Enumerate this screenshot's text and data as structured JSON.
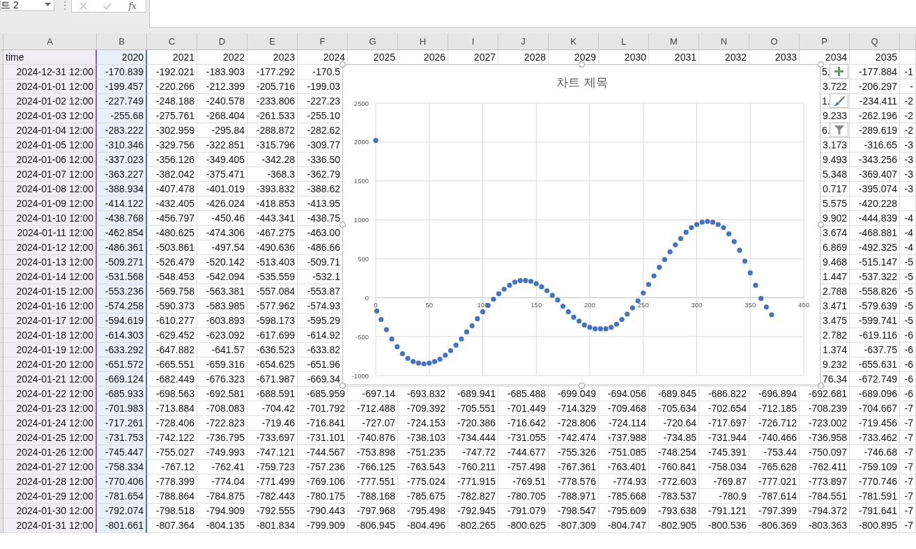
{
  "toolbar": {
    "name_box": "트 2",
    "function_button": "fx"
  },
  "sheet": {
    "columns": [
      {
        "letter": "A",
        "color": "#8064a2"
      },
      {
        "letter": "B",
        "color": "#4472c4"
      },
      {
        "letter": "C"
      },
      {
        "letter": "D"
      },
      {
        "letter": "E"
      },
      {
        "letter": "F"
      },
      {
        "letter": "G"
      },
      {
        "letter": "H"
      },
      {
        "letter": "I"
      },
      {
        "letter": "J"
      },
      {
        "letter": "K"
      },
      {
        "letter": "L"
      },
      {
        "letter": "M"
      },
      {
        "letter": "N"
      },
      {
        "letter": "O"
      },
      {
        "letter": "P"
      },
      {
        "letter": "Q"
      }
    ],
    "rows": [
      {
        "kind": "header",
        "cells": [
          "time",
          "2020",
          "2021",
          "2022",
          "2023",
          "2024",
          "2025",
          "2026",
          "2027",
          "2028",
          "2029",
          "2030",
          "2031",
          "2032",
          "2033",
          "2034",
          "2035",
          null
        ]
      },
      {
        "kind": "data",
        "cells": [
          "2024-12-31 12:00",
          "-170.839",
          "-192.021",
          "-183.903",
          "-177.292",
          "-170.5",
          null,
          null,
          null,
          null,
          null,
          null,
          null,
          null,
          null,
          "5.",
          "-177.884",
          "-1"
        ]
      },
      {
        "kind": "data",
        "cells": [
          "2024-01-01 12:00",
          "-199.457",
          "-220.266",
          "-212.399",
          "-205.716",
          "-199.03",
          null,
          null,
          null,
          null,
          null,
          null,
          null,
          null,
          null,
          "3.722",
          "-206.297",
          "-"
        ]
      },
      {
        "kind": "data",
        "cells": [
          "2024-01-02 12:00",
          "-227.749",
          "-248.188",
          "-240.578",
          "-233.806",
          "-227.23",
          null,
          null,
          null,
          null,
          null,
          null,
          null,
          null,
          null,
          "1.",
          "-234.411",
          "-2"
        ]
      },
      {
        "kind": "data",
        "cells": [
          "2024-01-03 12:00",
          "-255.68",
          "-275.761",
          "-268.404",
          "-261.533",
          "-255.10",
          null,
          null,
          null,
          null,
          null,
          null,
          null,
          null,
          null,
          "9.233",
          "-262.196",
          "-2"
        ]
      },
      {
        "kind": "data",
        "cells": [
          "2024-01-04 12:00",
          "-283.222",
          "-302.959",
          "-295.84",
          "-288.872",
          "-282.62",
          null,
          null,
          null,
          null,
          null,
          null,
          null,
          null,
          null,
          "6.",
          "-289.619",
          "-2"
        ]
      },
      {
        "kind": "data",
        "cells": [
          "2024-01-05 12:00",
          "-310.346",
          "-329.756",
          "-322.851",
          "-315.796",
          "-309.77",
          null,
          null,
          null,
          null,
          null,
          null,
          null,
          null,
          null,
          "3.173",
          "-316.65",
          "-3"
        ]
      },
      {
        "kind": "data",
        "cells": [
          "2024-01-06 12:00",
          "-337.023",
          "-356.126",
          "-349.405",
          "-342.28",
          "-336.50",
          null,
          null,
          null,
          null,
          null,
          null,
          null,
          null,
          null,
          "9.493",
          "-343.256",
          "-3"
        ]
      },
      {
        "kind": "data",
        "cells": [
          "2024-01-07 12:00",
          "-363.227",
          "-382.042",
          "-375.471",
          "-368.3",
          "-362.79",
          null,
          null,
          null,
          null,
          null,
          null,
          null,
          null,
          null,
          "5.348",
          "-369.407",
          "-3"
        ]
      },
      {
        "kind": "data",
        "cells": [
          "2024-01-08 12:00",
          "-388.934",
          "-407.478",
          "-401.019",
          "-393.832",
          "-388.62",
          null,
          null,
          null,
          null,
          null,
          null,
          null,
          null,
          null,
          "0.717",
          "-395.074",
          "-3"
        ]
      },
      {
        "kind": "data",
        "cells": [
          "2024-01-09 12:00",
          "-414.122",
          "-432.405",
          "-426.024",
          "-418.853",
          "-413.95",
          null,
          null,
          null,
          null,
          null,
          null,
          null,
          null,
          null,
          "5.575",
          "-420.228",
          null
        ]
      },
      {
        "kind": "data",
        "cells": [
          "2024-01-10 12:00",
          "-438.768",
          "-456.797",
          "-450.46",
          "-443.341",
          "-438.75",
          null,
          null,
          null,
          null,
          null,
          null,
          null,
          null,
          null,
          "9.902",
          "-444.839",
          "-4"
        ]
      },
      {
        "kind": "data",
        "cells": [
          "2024-01-11 12:00",
          "-462.854",
          "-480.625",
          "-474.306",
          "-467.275",
          "-463.00",
          null,
          null,
          null,
          null,
          null,
          null,
          null,
          null,
          null,
          "3.674",
          "-468.881",
          "-4"
        ]
      },
      {
        "kind": "data",
        "cells": [
          "2024-01-12 12:00",
          "-486.361",
          "-503.861",
          "-497.54",
          "-490.636",
          "-486.66",
          null,
          null,
          null,
          null,
          null,
          null,
          null,
          null,
          null,
          "6.869",
          "-492.325",
          "-4"
        ]
      },
      {
        "kind": "data",
        "cells": [
          "2024-01-13 12:00",
          "-509.271",
          "-526.479",
          "-520.142",
          "-513.403",
          "-509.71",
          null,
          null,
          null,
          null,
          null,
          null,
          null,
          null,
          null,
          "9.468",
          "-515.147",
          "-5"
        ]
      },
      {
        "kind": "data",
        "cells": [
          "2024-01-14 12:00",
          "-531.568",
          "-548.453",
          "-542.094",
          "-535.559",
          "-532.1",
          null,
          null,
          null,
          null,
          null,
          null,
          null,
          null,
          null,
          "1.447",
          "-537.322",
          "-5"
        ]
      },
      {
        "kind": "data",
        "cells": [
          "2024-01-15 12:00",
          "-553.236",
          "-569.758",
          "-563.381",
          "-557.084",
          "-553.87",
          null,
          null,
          null,
          null,
          null,
          null,
          null,
          null,
          null,
          "2.788",
          "-558.826",
          "-5"
        ]
      },
      {
        "kind": "data",
        "cells": [
          "2024-01-16 12:00",
          "-574.258",
          "-590.373",
          "-583.985",
          "-577.962",
          "-574.93",
          null,
          null,
          null,
          null,
          null,
          null,
          null,
          null,
          null,
          "3.471",
          "-579.639",
          "-5"
        ]
      },
      {
        "kind": "data",
        "cells": [
          "2024-01-17 12:00",
          "-594.619",
          "-610.277",
          "-603.893",
          "-598.173",
          "-595.29",
          null,
          null,
          null,
          null,
          null,
          null,
          null,
          null,
          null,
          "3.475",
          "-599.741",
          "-5"
        ]
      },
      {
        "kind": "data",
        "cells": [
          "2024-01-18 12:00",
          "-614.303",
          "-629.452",
          "-623.092",
          "-617.699",
          "-614.92",
          null,
          null,
          null,
          null,
          null,
          null,
          null,
          null,
          null,
          "2.782",
          "-619.116",
          "-6"
        ]
      },
      {
        "kind": "data",
        "cells": [
          "2024-01-19 12:00",
          "-633.292",
          "-647.882",
          "-641.57",
          "-636.523",
          "-633.82",
          null,
          null,
          null,
          null,
          null,
          null,
          null,
          null,
          null,
          "1.374",
          "-637.75",
          "-6"
        ]
      },
      {
        "kind": "data",
        "cells": [
          "2024-01-20 12:00",
          "-651.572",
          "-665.551",
          "-659.316",
          "-654.625",
          "-651.96",
          null,
          null,
          null,
          null,
          null,
          null,
          null,
          null,
          null,
          "9.232",
          "-655.631",
          "-6"
        ]
      },
      {
        "kind": "data",
        "cells": [
          "2024-01-21 12:00",
          "-669.124",
          "-682.449",
          "-676.323",
          "-671.987",
          "-669.34",
          null,
          null,
          null,
          null,
          null,
          null,
          null,
          null,
          null,
          "76.34",
          "-672.749",
          "-6"
        ]
      },
      {
        "kind": "data",
        "cells": [
          "2024-01-22 12:00",
          "-685.933",
          "-698.563",
          "-692.581",
          "-688.591",
          "-685.959",
          "-697.14",
          "-693.832",
          "-689.941",
          "-685.488",
          "-699.049",
          "-694.056",
          "-689.845",
          "-686.822",
          "-696.894",
          "-692.681",
          "-689.096",
          "-6"
        ]
      },
      {
        "kind": "data",
        "cells": [
          "2024-01-23 12:00",
          "-701.983",
          "-713.884",
          "-708.083",
          "-704.42",
          "-701.792",
          "-712.488",
          "-709.392",
          "-705.551",
          "-701.449",
          "-714.329",
          "-709.468",
          "-705.634",
          "-702.654",
          "-712.185",
          "-708.239",
          "-704.667",
          "-7"
        ]
      },
      {
        "kind": "data",
        "cells": [
          "2024-01-24 12:00",
          "-717.261",
          "-728.406",
          "-722.823",
          "-719.46",
          "-716.841",
          "-727.07",
          "-724.153",
          "-720.386",
          "-716.642",
          "-728.806",
          "-724.114",
          "-720.64",
          "-717.697",
          "-726.712",
          "-723.002",
          "-719.456",
          "-7"
        ]
      },
      {
        "kind": "data",
        "cells": [
          "2024-01-25 12:00",
          "-731.753",
          "-742.122",
          "-736.795",
          "-733.697",
          "-731.101",
          "-740.876",
          "-738.103",
          "-734.444",
          "-731.055",
          "-742.474",
          "-737.988",
          "-734.85",
          "-731.944",
          "-740.466",
          "-736.958",
          "-733.462",
          "-7"
        ]
      },
      {
        "kind": "data",
        "cells": [
          "2024-01-26 12:00",
          "-745.447",
          "-755.027",
          "-749.993",
          "-747.121",
          "-744.567",
          "-753.898",
          "-751.235",
          "-747.72",
          "-744.677",
          "-755.326",
          "-751.085",
          "-748.254",
          "-745.391",
          "-753.44",
          "-750.097",
          "-746.68",
          "-7"
        ]
      },
      {
        "kind": "data",
        "cells": [
          "2024-01-27 12:00",
          "-758.334",
          "-767.12",
          "-762.41",
          "-759.723",
          "-757.236",
          "-766.125",
          "-763.543",
          "-760.211",
          "-757.498",
          "-767.361",
          "-763.401",
          "-760.841",
          "-758.034",
          "-765.628",
          "-762.411",
          "-759.109",
          "-7"
        ]
      },
      {
        "kind": "data",
        "cells": [
          "2024-01-28 12:00",
          "-770.406",
          "-778.399",
          "-774.04",
          "-771.499",
          "-769.106",
          "-777.551",
          "-775.024",
          "-771.915",
          "-769.51",
          "-778.576",
          "-774.93",
          "-772.603",
          "-769.87",
          "-777.021",
          "-773.897",
          "-770.746",
          "-7"
        ]
      },
      {
        "kind": "data",
        "cells": [
          "2024-01-29 12:00",
          "-781.654",
          "-788.864",
          "-784.875",
          "-782.443",
          "-780.175",
          "-788.168",
          "-785.675",
          "-782.827",
          "-780.705",
          "-788.971",
          "-785.668",
          "-783.537",
          "-780.9",
          "-787.614",
          "-784.551",
          "-781.591",
          "-7"
        ]
      },
      {
        "kind": "data",
        "cells": [
          "2024-01-30 12:00",
          "-792.074",
          "-798.518",
          "-794.909",
          "-792.555",
          "-790.443",
          "-797.968",
          "-795.498",
          "-792.945",
          "-791.079",
          "-798.547",
          "-795.609",
          "-793.638",
          "-791.121",
          "-797.399",
          "-794.372",
          "-791.641",
          "-7"
        ]
      },
      {
        "kind": "data",
        "cells": [
          "2024-01-31 12:00",
          "-801.661",
          "-807.364",
          "-804.135",
          "-801.834",
          "-799.909",
          "-806.945",
          "-804.496",
          "-802.265",
          "-800.625",
          "-807.309",
          "-804.747",
          "-802.905",
          "-800.536",
          "-806.369",
          "-803.363",
          "-800.895",
          "-7"
        ]
      }
    ]
  },
  "chart": {
    "chart_data": {
      "type": "scatter",
      "title": "차트 제목",
      "xlim": [
        0,
        400
      ],
      "ylim": [
        -1000,
        2500
      ],
      "xticks": [
        0,
        50,
        100,
        150,
        200,
        250,
        300,
        350,
        400
      ],
      "yticks": [
        -1000,
        -500,
        0,
        500,
        1000,
        1500,
        2000,
        2500
      ],
      "x": [
        0,
        1,
        5,
        10,
        15,
        20,
        25,
        30,
        35,
        40,
        45,
        50,
        55,
        60,
        65,
        70,
        75,
        80,
        85,
        90,
        95,
        100,
        105,
        110,
        115,
        120,
        125,
        130,
        135,
        140,
        145,
        150,
        155,
        160,
        165,
        170,
        175,
        180,
        185,
        190,
        195,
        200,
        205,
        210,
        215,
        220,
        225,
        230,
        235,
        240,
        245,
        250,
        255,
        260,
        265,
        270,
        275,
        280,
        285,
        290,
        295,
        300,
        305,
        310,
        315,
        320,
        325,
        330,
        335,
        340,
        345,
        350,
        355,
        360,
        365,
        370
      ],
      "series": [
        {
          "color": "#4472c4",
          "values": [
            2020,
            -170,
            -280,
            -410,
            -530,
            -630,
            -720,
            -780,
            -820,
            -840,
            -850,
            -840,
            -820,
            -790,
            -740,
            -680,
            -610,
            -530,
            -440,
            -360,
            -270,
            -180,
            -100,
            -20,
            50,
            110,
            160,
            200,
            220,
            220,
            210,
            180,
            140,
            90,
            30,
            -30,
            -110,
            -180,
            -250,
            -300,
            -350,
            -380,
            -400,
            -400,
            -400,
            -380,
            -340,
            -280,
            -210,
            -130,
            -40,
            60,
            170,
            280,
            390,
            490,
            590,
            680,
            760,
            840,
            900,
            940,
            970,
            980,
            970,
            940,
            900,
            820,
            720,
            610,
            470,
            320,
            160,
            -10,
            -120,
            -220
          ]
        }
      ],
      "grid": true
    }
  }
}
